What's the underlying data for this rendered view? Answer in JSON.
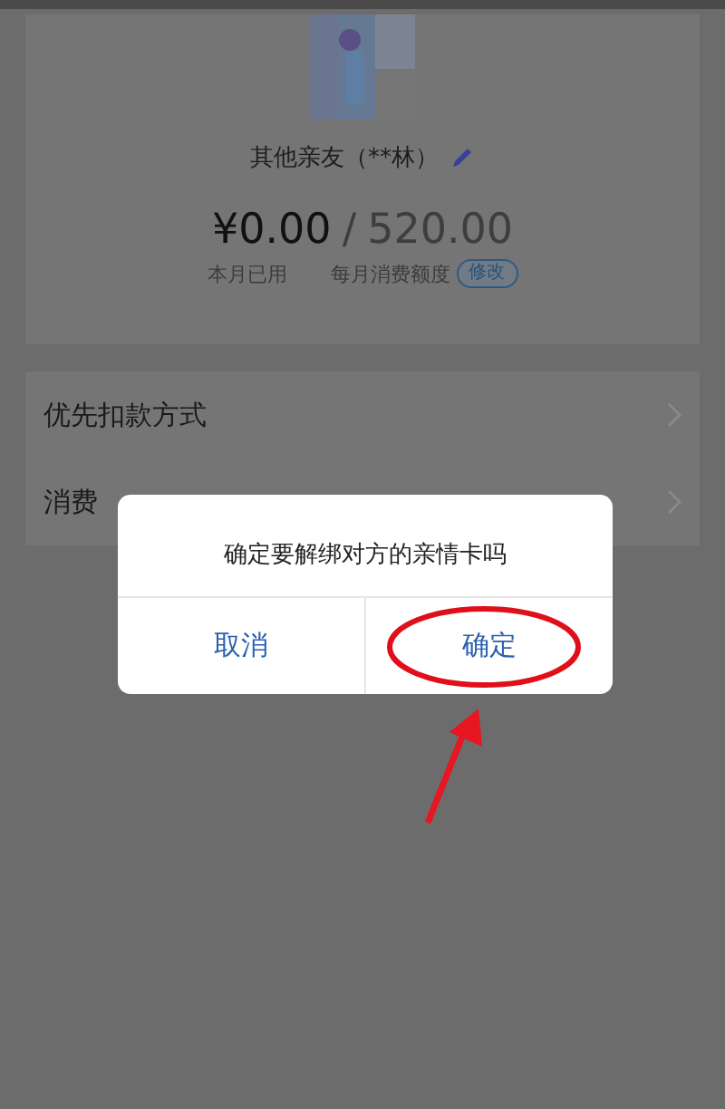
{
  "profile": {
    "name": "其他亲友（**林）",
    "spent": "¥0.00",
    "separator": "/",
    "limit": "520.00",
    "spent_label": "本月已用",
    "limit_label": "每月消费额度",
    "edit_button": "修改"
  },
  "menu": [
    {
      "label": "优先扣款方式"
    },
    {
      "label": "消费"
    }
  ],
  "dialog": {
    "message": "确定要解绑对方的亲情卡吗",
    "buttons": [
      {
        "label": "取消",
        "highlighted": false
      },
      {
        "label": "确定",
        "highlighted": true
      }
    ]
  }
}
